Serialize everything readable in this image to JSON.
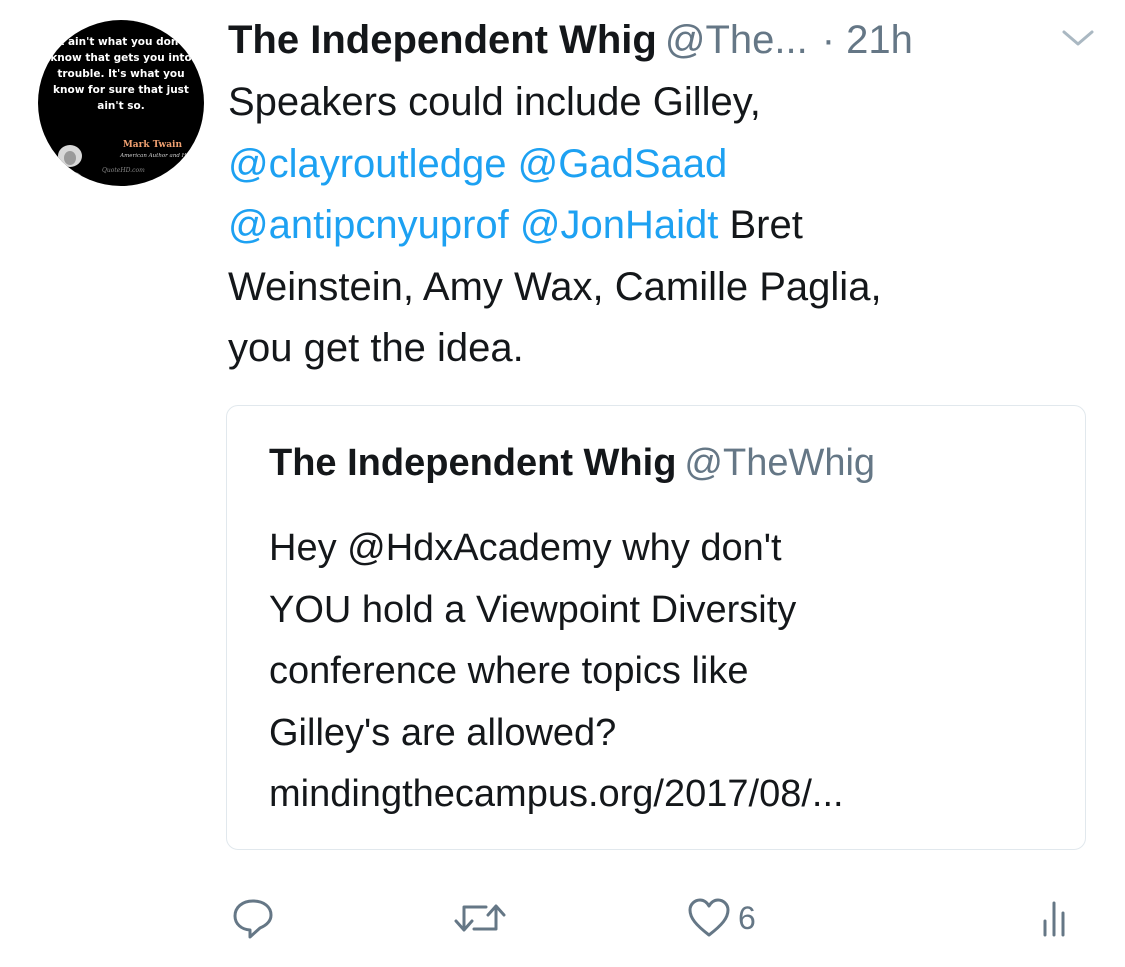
{
  "tweet": {
    "author": {
      "display_name": "The Independent Whig",
      "handle": "@The...",
      "avatar_quote": "It ain't what you don't know that gets you into trouble. It's what you know for sure that just ain't so.",
      "avatar_author": "Mark Twain",
      "avatar_subtitle": "American Author and Hu",
      "avatar_site": "QuoteHD.com"
    },
    "time": "· 21h",
    "text_lines": [
      "Speakers could include Gilley,",
      "@clayroutledge @GadSaad",
      "@antipcnyuprof @JonHaidt",
      " Bret",
      "Weinstein, Amy Wax, Camille Paglia,",
      "you get the idea."
    ],
    "quoted": {
      "display_name": "The Independent Whig",
      "handle": "@TheWhig",
      "text_lines": [
        "Hey @HdxAcademy why don't",
        "YOU hold a Viewpoint Diversity",
        "conference where topics like",
        "Gilley's are allowed?",
        "mindingthecampus.org/2017/08/..."
      ]
    },
    "actions": {
      "reply_icon": "reply-icon",
      "retweet_icon": "retweet-icon",
      "like_icon": "heart-icon",
      "like_count": "6",
      "analytics_icon": "analytics-icon"
    }
  },
  "colors": {
    "link": "#1da1f2",
    "secondary": "#657786",
    "text": "#14171a",
    "border": "#e1e8ed"
  }
}
